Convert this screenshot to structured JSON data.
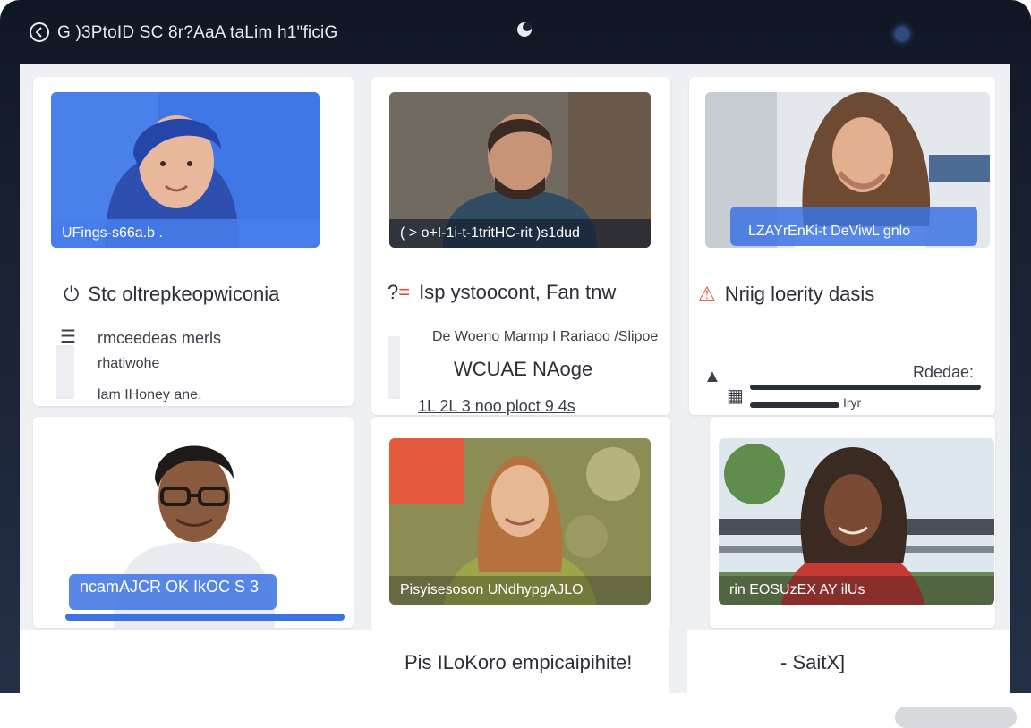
{
  "window": {
    "title": "G )3PtoID SC 8r?AaA taLim h1\"ficiG",
    "back_icon": "back-circle-icon",
    "center_icon": "moon-icon",
    "camera_icon": "camera-dot-icon"
  },
  "cards": [
    {
      "caption": "UFings-s66a.b .",
      "heading": "Stc oltrepkeopwiconia",
      "heading_icon": "power-icon",
      "lines": [
        "rmceedeas merls",
        "rhatiwohe",
        "lam IHoney ane."
      ],
      "lines_icon": "list-icon"
    },
    {
      "caption": "( > o+I-1i-t-1tritHC-rit )s1dud",
      "heading": "Isp ystoocont, Fan tnw",
      "heading_icon": "wifi-icon",
      "sub": "De Woeno Marmp I Rariaoo /Slipoe",
      "subtitle": "WCUAE NAoge",
      "bottom": "1L 2L 3 noo ploct 9 4s"
    },
    {
      "caption": "LZAYrEnKi-t DeViwL gnlo",
      "heading": "Nriig loerity dasis",
      "heading_icon": "alert-icon",
      "side_label": "Rdedae:",
      "footnote": "Iryr"
    },
    {
      "caption": "ncamAJCR OK IkOC S 3"
    },
    {
      "caption": "Pisyisesoson UNdhypgAJLO"
    },
    {
      "caption": "rin EOSUzEX AY ilUs"
    }
  ],
  "footer": {
    "center_text": "Pis ILoKoro empicaipihite!",
    "right_text": "- SaitX]"
  }
}
